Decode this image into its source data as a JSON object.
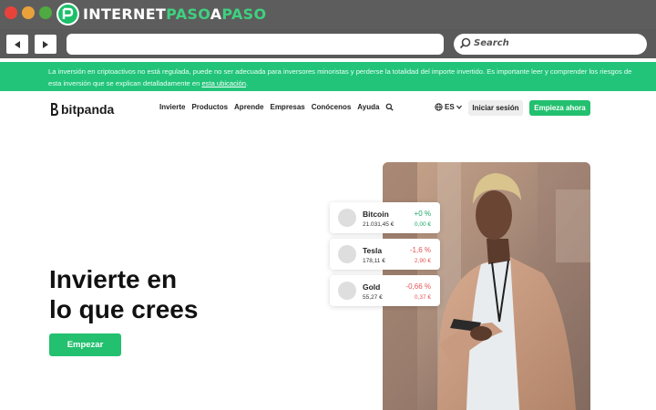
{
  "browser": {
    "brand_prefix": "INTERNET",
    "brand_accent_1": "PASO",
    "brand_mid": "A",
    "brand_accent_2": "PASO",
    "search_placeholder": "Search",
    "url": ""
  },
  "banner": {
    "text": "La inversión en criptoactivos no está regulada, puede no ser adecuada para inversores minoristas y perderse la totalidad del importe invertido. Es importante leer y comprender los riesgos de esta inversión que se explican detalladamente en ",
    "link": "esta ubicación",
    "end": "."
  },
  "site": {
    "logo_text": "bitpanda",
    "nav": [
      "Invierte",
      "Productos",
      "Aprende",
      "Empresas",
      "Conócenos",
      "Ayuda"
    ],
    "lang": "ES",
    "login": "Iniciar sesión",
    "signup": "Empieza ahora"
  },
  "hero": {
    "title_line1": "Invierte en",
    "title_line2": "lo que crees",
    "cta": "Empezar"
  },
  "assets": [
    {
      "name": "Bitcoin",
      "price": "21.031,45 €",
      "change": "+0 %",
      "delta": "0,00 €",
      "trend": "pos"
    },
    {
      "name": "Tesla",
      "price": "178,11 €",
      "change": "-1,6 %",
      "delta": "2,90 €",
      "trend": "neg"
    },
    {
      "name": "Gold",
      "price": "55,27 €",
      "change": "-0,66 %",
      "delta": "0,37 €",
      "trend": "neg"
    }
  ],
  "colors": {
    "brand_green": "#23c06f",
    "banner_green": "#22c47a",
    "positive": "#1ba866",
    "negative": "#e45555"
  },
  "icons": [
    "back-arrow-icon",
    "forward-arrow-icon",
    "search-icon",
    "globe-icon",
    "chevron-down-icon",
    "bitpanda-logo-icon"
  ]
}
